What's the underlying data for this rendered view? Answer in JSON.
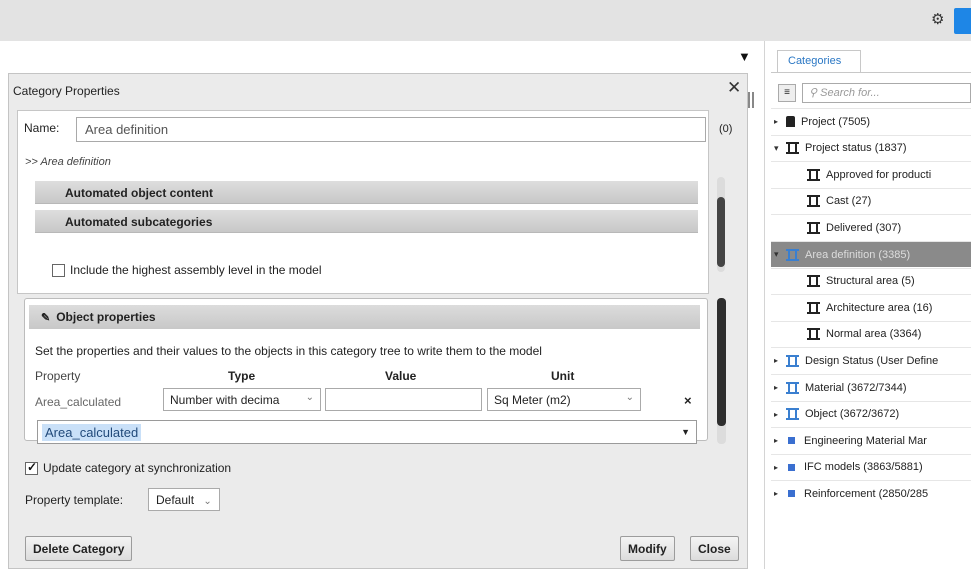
{
  "topbar": {
    "gear": "gear-icon"
  },
  "dialog": {
    "title": "Category Properties",
    "close": "✕",
    "name_label": "Name:",
    "name_value": "Area definition",
    "name_count": "(0)",
    "breadcrumb": ">> Area definition",
    "bars": [
      "Automated object content",
      "Automated subcategories"
    ],
    "include_highest_label": "Include the highest assembly level in the model",
    "include_highest_checked": false,
    "object_properties": {
      "title": "Object properties",
      "description": "Set the properties and their values to the objects in this category tree to write them to the model",
      "columns": [
        "Property",
        "Type",
        "Value",
        "Unit"
      ],
      "row": {
        "property": "Area_calculated",
        "type": "Number with decima",
        "value": "",
        "unit": "Sq Meter (m2)",
        "delete": "×"
      },
      "combo_value": "Area_calculated"
    },
    "update_label": "Update category at synchronization",
    "update_checked": true,
    "template_label": "Property template:",
    "template_value": "Default",
    "buttons": {
      "delete": "Delete Category",
      "modify": "Modify",
      "close": "Close"
    }
  },
  "categories": {
    "tab": "Categories",
    "search_placeholder": "Search for...",
    "tree": [
      {
        "label": "Project (7505)",
        "level": 0,
        "icon": "project-icon",
        "expand": "▶"
      },
      {
        "label": "Project status (1837)",
        "level": 0,
        "icon": "category-icon",
        "expand": "◢"
      },
      {
        "label": "Approved for producti",
        "level": 1,
        "icon": "category-icon",
        "expand": ""
      },
      {
        "label": "Cast (27)",
        "level": 1,
        "icon": "category-icon",
        "expand": ""
      },
      {
        "label": "Delivered (307)",
        "level": 1,
        "icon": "category-icon",
        "expand": ""
      },
      {
        "label": "Area definition (3385)",
        "level": 0,
        "icon": "category-icon",
        "expand": "◢",
        "selected": true
      },
      {
        "label": "Structural area (5)",
        "level": 1,
        "icon": "category-icon",
        "expand": ""
      },
      {
        "label": "Architecture area (16)",
        "level": 1,
        "icon": "category-icon",
        "expand": ""
      },
      {
        "label": "Normal area (3364)",
        "level": 1,
        "icon": "category-icon",
        "expand": ""
      },
      {
        "label": "Design Status (User Define",
        "level": 0,
        "icon": "category-icon-blue",
        "expand": "▶"
      },
      {
        "label": "Material (3672/7344)",
        "level": 0,
        "icon": "category-icon-blue",
        "expand": "▶"
      },
      {
        "label": "Object (3672/3672)",
        "level": 0,
        "icon": "category-icon-blue",
        "expand": "▶"
      },
      {
        "label": "Engineering Material Mar",
        "level": 0,
        "icon": "square-icon",
        "expand": "▶"
      },
      {
        "label": "IFC models (3863/5881)",
        "level": 0,
        "icon": "square-icon",
        "expand": "▶"
      },
      {
        "label": "Reinforcement (2850/285",
        "level": 0,
        "icon": "square-icon",
        "expand": "▶"
      }
    ]
  },
  "colors": {
    "accent": "#1e86e6",
    "selected_row": "#8a8a8a",
    "icon_blue": "#3a7fd0"
  }
}
